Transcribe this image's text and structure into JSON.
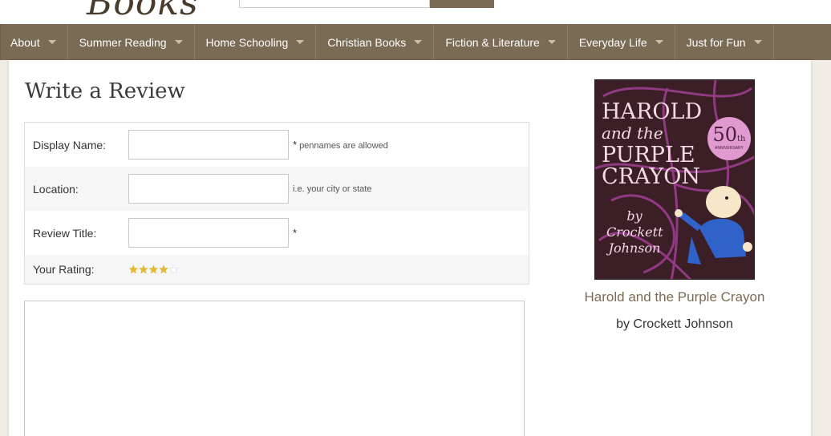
{
  "header": {
    "logo_text": "Books"
  },
  "nav": {
    "items": [
      {
        "label": "About"
      },
      {
        "label": "Summer Reading"
      },
      {
        "label": "Home Schooling"
      },
      {
        "label": "Christian Books"
      },
      {
        "label": "Fiction & Literature"
      },
      {
        "label": "Everyday Life"
      },
      {
        "label": "Just for Fun"
      }
    ]
  },
  "main": {
    "title": "Write a Review",
    "form": {
      "display_name": {
        "label": "Display Name:",
        "value": "",
        "hint_marker": "*",
        "hint": "pennames are allowed"
      },
      "location": {
        "label": "Location:",
        "value": "",
        "hint": "i.e. your city or state"
      },
      "review_title": {
        "label": "Review Title:",
        "value": "",
        "hint_marker": "*"
      },
      "rating": {
        "label": "Your Rating:",
        "value": 4,
        "max": 5
      }
    },
    "review_body": {
      "value": ""
    }
  },
  "book": {
    "cover": {
      "title_line1": "HAROLD",
      "title_line2": "and the",
      "title_line3": "PURPLE",
      "title_line4": "CRAYON",
      "badge_number": "50",
      "badge_suffix": "th",
      "badge_text": "ANNIVERSARY",
      "author_by": "by",
      "author_line1": "Crockett",
      "author_line2": "Johnson"
    },
    "title": "Harold and the Purple Crayon",
    "author": "by Crockett Johnson"
  },
  "colors": {
    "nav_bg": "#7a6b55",
    "page_bg": "#f1ede6",
    "link": "#7a6b55",
    "star_on": "#e8b923"
  }
}
